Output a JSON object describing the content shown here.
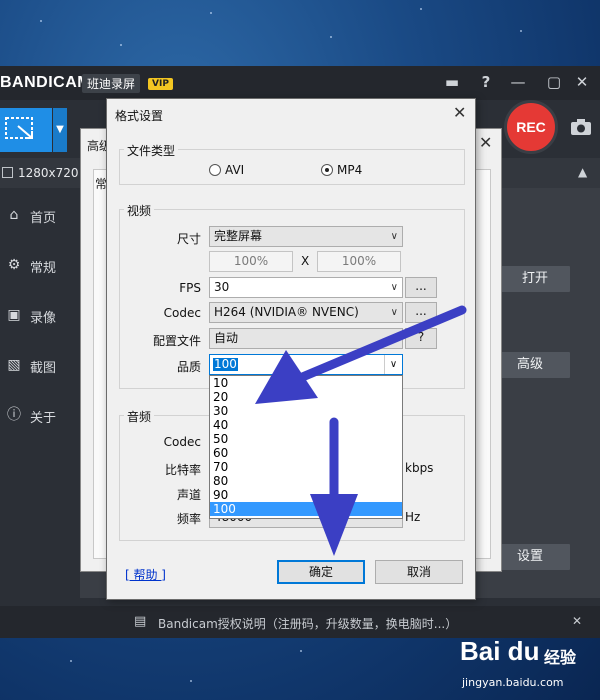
{
  "app": {
    "logo": "BANDICAM",
    "logo_cn": "班迪录屏",
    "vip": "VIP",
    "rec_label": "REC",
    "resolution": "1280x720 -",
    "sidebar": [
      {
        "icon": "home-icon",
        "label": "首页"
      },
      {
        "icon": "gear-icon",
        "label": "常规"
      },
      {
        "icon": "video-settings-icon",
        "label": "录像"
      },
      {
        "icon": "image-icon",
        "label": "截图"
      },
      {
        "icon": "info-icon",
        "label": "关于"
      }
    ],
    "open_button": "打开",
    "advanced_button": "高级",
    "settings_button": "设置",
    "status_text": "Bandicam授权说明（注册码，升级数量，换电脑时...）"
  },
  "bg_dialog": {
    "title": "高级",
    "tab": "常"
  },
  "format_dialog": {
    "title": "格式设置",
    "file_type": {
      "group_label": "文件类型",
      "options": [
        "AVI",
        "MP4"
      ],
      "selected": "MP4"
    },
    "video": {
      "group_label": "视频",
      "size_label": "尺寸",
      "size_value": "完整屏幕",
      "width_pct": "100%",
      "x_label": "X",
      "height_pct": "100%",
      "fps_label": "FPS",
      "fps_value": "30",
      "codec_label": "Codec",
      "codec_value": "H264 (NVIDIA® NVENC)",
      "profile_label": "配置文件",
      "profile_value": "自动",
      "quality_label": "品质",
      "quality_value": "100",
      "quality_options": [
        "10",
        "20",
        "30",
        "40",
        "50",
        "60",
        "70",
        "80",
        "90",
        "100"
      ],
      "ellipsis": "...",
      "question": "?"
    },
    "audio": {
      "group_label": "音频",
      "codec_label": "Codec",
      "bitrate_label": "比特率",
      "bitrate_unit": "kbps",
      "channels_label": "声道",
      "freq_label": "频率",
      "freq_value": "48000",
      "freq_unit": "Hz"
    },
    "help_link": "[ 帮助 ]",
    "ok_button": "确定",
    "cancel_button": "取消"
  },
  "watermark": {
    "logo": "Bai du",
    "cn": "经验",
    "url": "jingyan.baidu.com"
  },
  "colors": {
    "accent_blue": "#1f8ee6",
    "rec_red": "#e53935",
    "arrow_blue": "#3b3fc4",
    "selection_blue": "#3399ff"
  }
}
